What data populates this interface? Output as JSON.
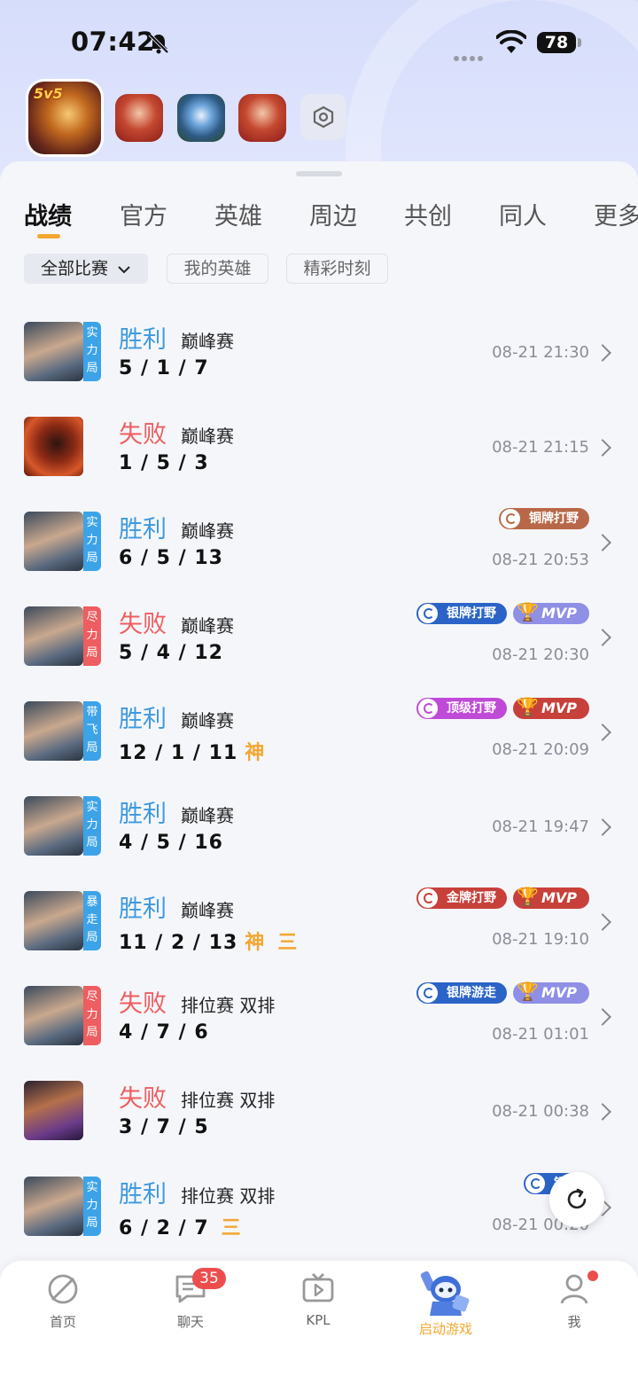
{
  "status_bar": {
    "time": "07:42",
    "battery": "78"
  },
  "game_icons": [
    "honor-of-kings",
    "game-2",
    "game-3",
    "game-4",
    "settings-hex"
  ],
  "tabs": [
    "战绩",
    "官方",
    "英雄",
    "周边",
    "共创",
    "同人",
    "更多"
  ],
  "filters": {
    "all_matches": "全部比赛",
    "my_heroes": "我的英雄",
    "highlights": "精彩时刻"
  },
  "rows": [
    {
      "result": "胜利",
      "result_type": "win",
      "mode_tag": "实力局",
      "match_type": "巅峰赛",
      "kda": "5 / 1 / 7",
      "time": "08-21 21:30"
    },
    {
      "result": "失败",
      "result_type": "lose",
      "mode_tag": "",
      "match_type": "巅峰赛",
      "kda": "1 / 5 / 3",
      "time": "08-21 21:15"
    },
    {
      "result": "胜利",
      "result_type": "win",
      "mode_tag": "实力局",
      "match_type": "巅峰赛",
      "kda": "6 / 5 / 13",
      "time": "08-21 20:53",
      "badges": [
        {
          "label": "铜牌打野"
        }
      ]
    },
    {
      "result": "失败",
      "result_type": "lose",
      "mode_tag": "尽力局",
      "match_type": "巅峰赛",
      "kda": "5 / 4 / 12",
      "time": "08-21 20:30",
      "badges": [
        {
          "label": "银牌打野"
        }
      ],
      "mvp": "MVP"
    },
    {
      "result": "胜利",
      "result_type": "win",
      "mode_tag": "带飞局",
      "match_type": "巅峰赛",
      "kda": "12 / 1 / 11",
      "shen": "神",
      "time": "08-21 20:09",
      "badges": [
        {
          "label": "顶级打野"
        }
      ],
      "mvp": "MVP"
    },
    {
      "result": "胜利",
      "result_type": "win",
      "mode_tag": "实力局",
      "match_type": "巅峰赛",
      "kda": "4 / 5 / 16",
      "time": "08-21 19:47"
    },
    {
      "result": "胜利",
      "result_type": "win",
      "mode_tag": "暴走局",
      "match_type": "巅峰赛",
      "kda": "11 / 2 / 13",
      "shen": "神",
      "san": "三",
      "time": "08-21 19:10",
      "badges": [
        {
          "label": "金牌打野"
        }
      ],
      "mvp": "MVP"
    },
    {
      "result": "失败",
      "result_type": "lose",
      "mode_tag": "尽力局",
      "match_type": "排位赛 双排",
      "kda": "4 / 7 / 6",
      "time": "08-21 01:01",
      "badges": [
        {
          "label": "银牌游走"
        }
      ],
      "mvp": "MVP"
    },
    {
      "result": "失败",
      "result_type": "lose",
      "mode_tag": "",
      "match_type": "排位赛 双排",
      "kda": "3 / 7 / 5",
      "time": "08-21 00:38"
    },
    {
      "result": "胜利",
      "result_type": "win",
      "mode_tag": "实力局",
      "match_type": "排位赛 双排",
      "kda": "6 / 2 / 7",
      "san": "三",
      "time": "08-21 00:20",
      "badges": [
        {
          "label": "银牌"
        }
      ]
    }
  ],
  "bottom_nav": [
    {
      "label": "首页",
      "icon": "home-icon"
    },
    {
      "label": "聊天",
      "icon": "chat-icon",
      "badge": "35"
    },
    {
      "label": "KPL",
      "icon": "tv-icon"
    },
    {
      "label": "启动游戏",
      "icon": "robot-icon"
    },
    {
      "label": "我",
      "icon": "person-icon"
    }
  ],
  "colors": {
    "win": "#3e9ae0",
    "lose": "#ee5d5f",
    "accent": "#f3a630"
  }
}
